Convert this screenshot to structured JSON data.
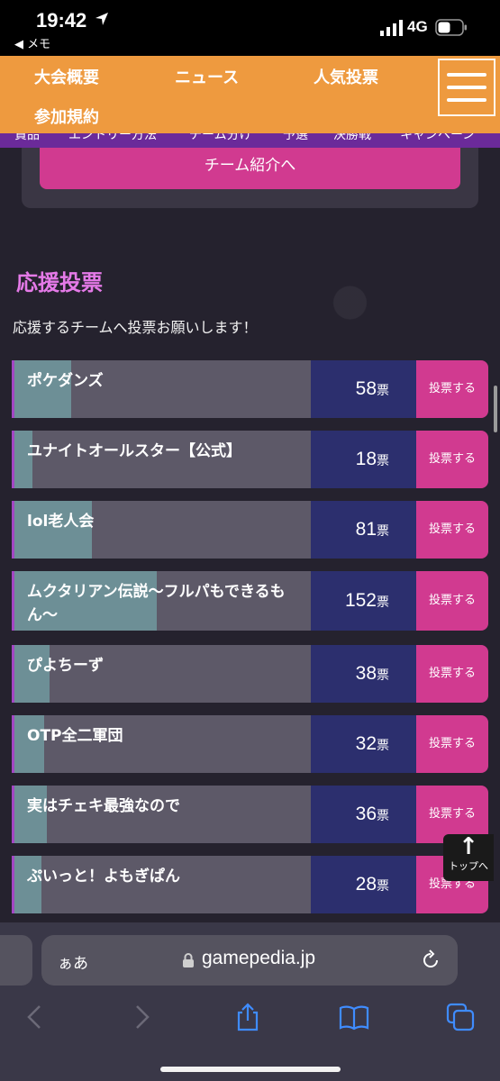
{
  "status_bar": {
    "time": "19:42",
    "back_app": "◀ メモ",
    "network": "4G"
  },
  "header": {
    "nav": [
      "大会概要",
      "ニュース",
      "人気投票",
      "参加規約"
    ]
  },
  "submenu": [
    "賞品",
    "エントリー方法",
    "チーム分け",
    "予選",
    "決勝戦",
    "キャンペーン"
  ],
  "team_card": {
    "button_label": "チーム紹介へ"
  },
  "section": {
    "title": "応援投票",
    "description": "応援するチームへ投票お願いします！"
  },
  "vote": {
    "unit": "票",
    "button_label": "投票する",
    "teams": [
      {
        "name": "ポケダンズ",
        "votes": "58",
        "share": 0.19
      },
      {
        "name": "ユナイトオールスター【公式】",
        "votes": "18",
        "share": 0.06
      },
      {
        "name": "lol老人会",
        "votes": "81",
        "share": 0.26
      },
      {
        "name": "ムクタリアン伝説〜フルパもできるもん〜",
        "votes": "152",
        "share": 0.48
      },
      {
        "name": "ぴよちーず",
        "votes": "38",
        "share": 0.12
      },
      {
        "name": "OTP全二軍団",
        "votes": "32",
        "share": 0.1
      },
      {
        "name": "実はチェキ最強なので",
        "votes": "36",
        "share": 0.11
      },
      {
        "name": "ぷいっと！よもぎぱん",
        "votes": "28",
        "share": 0.09
      }
    ]
  },
  "to_top": {
    "arrow": "↑",
    "label": "トップへ"
  },
  "browser": {
    "aa": "ぁあ",
    "domain": "gamepedia.jp"
  },
  "colors": {
    "header": "#ee9a3f",
    "accent_pink": "#d13a90",
    "section_title": "#e57ae8",
    "count_bg": "#2c2f6e"
  }
}
